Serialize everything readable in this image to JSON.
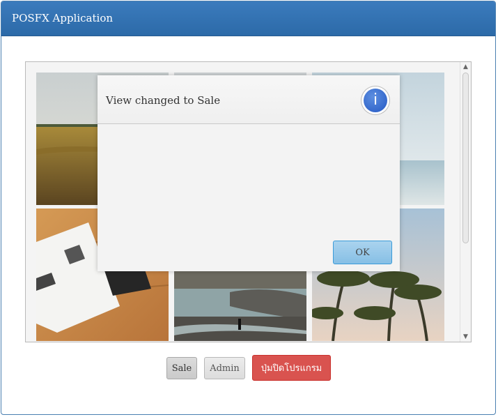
{
  "window": {
    "title": "POSFX Application"
  },
  "gallery": {
    "images": [
      {
        "name": "wheat-field-photo"
      },
      {
        "name": "cloudy-sky-photo"
      },
      {
        "name": "calm-sea-photo"
      },
      {
        "name": "open-book-on-wooden-table-photo"
      },
      {
        "name": "river-with-rocks-photo"
      },
      {
        "name": "palm-trees-photo"
      }
    ]
  },
  "buttons": {
    "sale": "Sale",
    "admin": "Admin",
    "quit": "ปุ่มปิดโปรแกรม"
  },
  "dialog": {
    "message": "View changed to Sale",
    "icon": "info-icon",
    "ok": "OK"
  },
  "colors": {
    "titlebar": "#2e6eae",
    "quit_button": "#d9534f",
    "ok_button": "#9ccbeb",
    "info_icon": "#2f62c9"
  }
}
